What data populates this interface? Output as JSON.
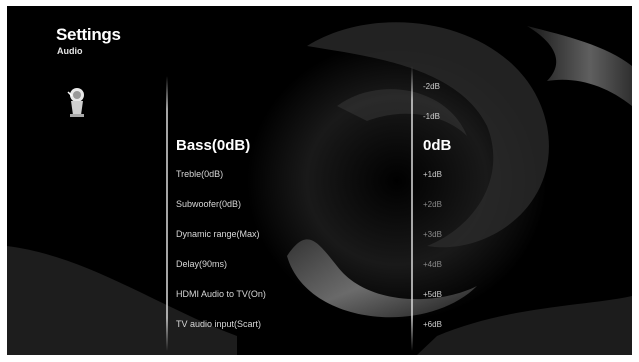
{
  "header": {
    "title": "Settings",
    "subtitle": "Audio",
    "icon": "speaker-icon"
  },
  "menu": {
    "items": [
      {
        "label": "Bass(0dB)",
        "active": true
      },
      {
        "label": "Treble(0dB)"
      },
      {
        "label": "Subwoofer(0dB)"
      },
      {
        "label": "Dynamic range(Max)"
      },
      {
        "label": "Delay(90ms)"
      },
      {
        "label": "HDMI Audio to TV(On)"
      },
      {
        "label": "TV audio input(Scart)"
      }
    ]
  },
  "values": {
    "items": [
      {
        "label": "-2dB"
      },
      {
        "label": "-1dB"
      },
      {
        "label": "0dB",
        "active": true
      },
      {
        "label": "+1dB"
      },
      {
        "label": "+2dB"
      },
      {
        "label": "+3dB"
      },
      {
        "label": "+4dB"
      },
      {
        "label": "+5dB"
      },
      {
        "label": "+6dB"
      }
    ]
  },
  "colors": {
    "background": "#000000",
    "text": "#ffffff",
    "inactive_text": "#d8d8d8",
    "divider": "#dcdcdc"
  }
}
